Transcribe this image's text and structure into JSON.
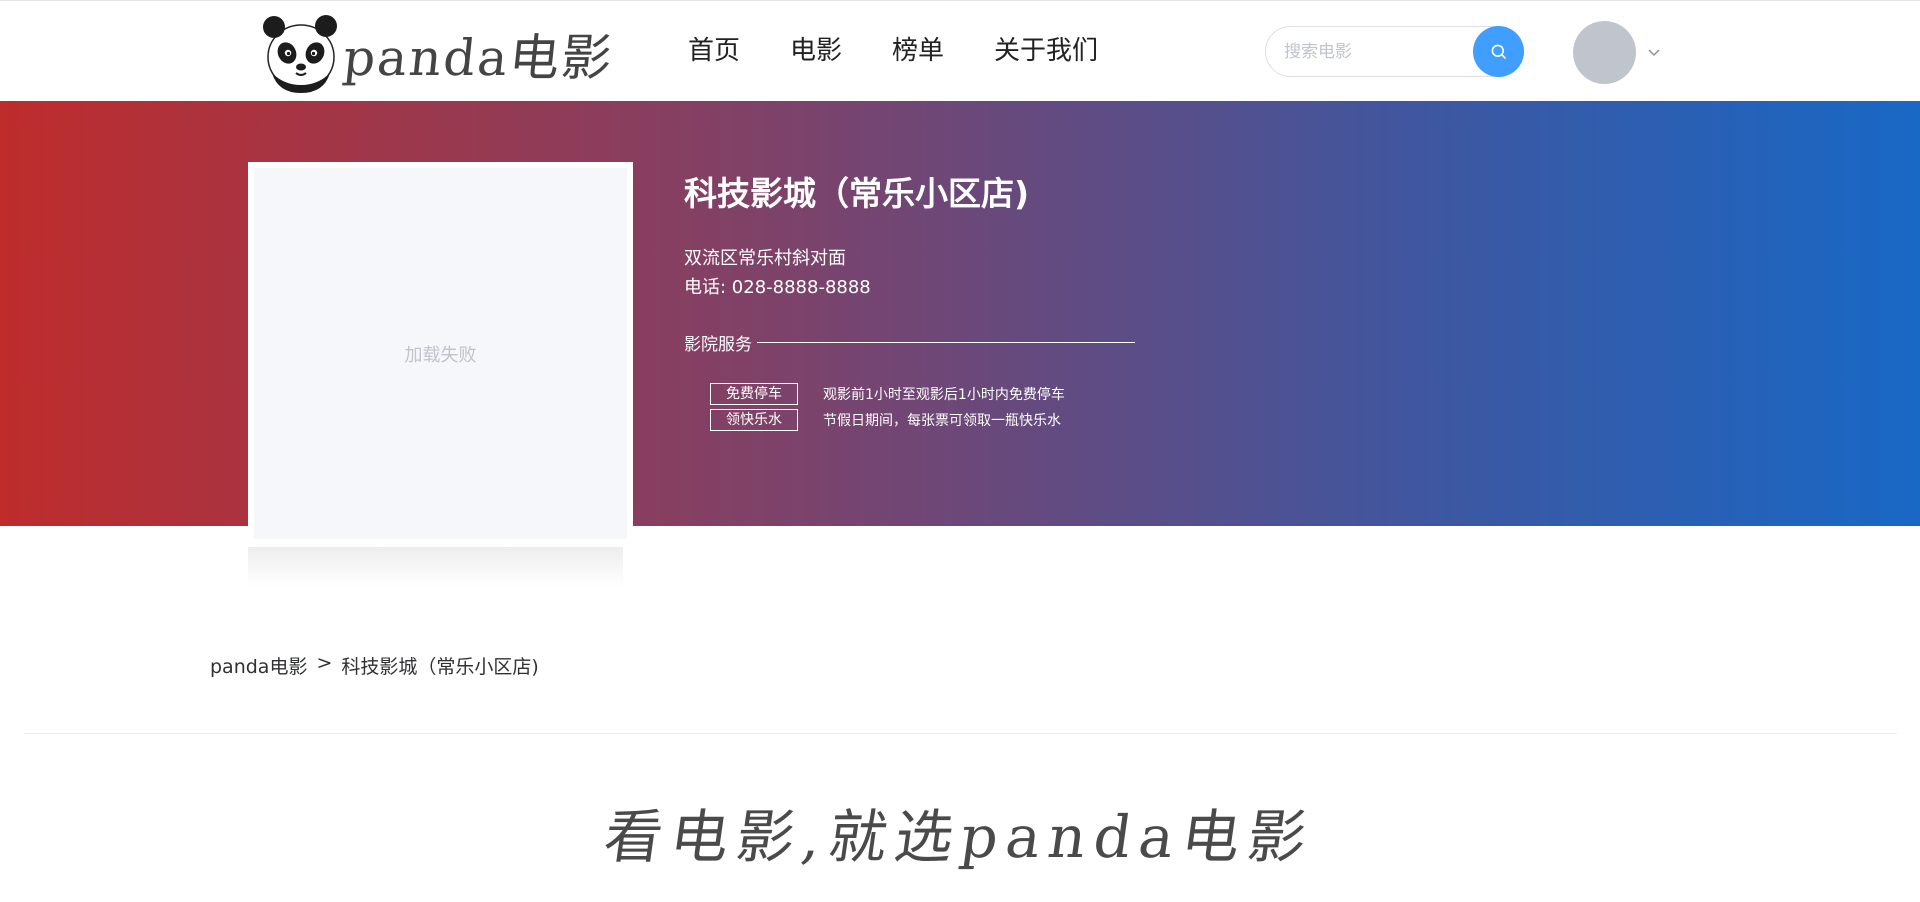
{
  "header": {
    "logo_text": "panda电影",
    "nav": [
      {
        "label": "首页"
      },
      {
        "label": "电影"
      },
      {
        "label": "榜单"
      },
      {
        "label": "关于我们"
      }
    ],
    "search": {
      "placeholder": "搜索电影",
      "value": ""
    },
    "icons": [
      "panda-logo-icon",
      "search-icon",
      "chevron-down-icon"
    ],
    "accent_color": "#409eff"
  },
  "cinema": {
    "poster_status": "加载失败",
    "name": "科技影城（常乐小区店)",
    "address": "双流区常乐村斜对面",
    "phone": "电话: 028-8888-8888",
    "services_title": "影院服务",
    "services": [
      {
        "tag": "免费停车",
        "desc": "观影前1小时至观影后1小时内免费停车"
      },
      {
        "tag": "领快乐水",
        "desc": "节假日期间，每张票可领取一瓶快乐水"
      }
    ],
    "banner_colors": [
      "#be2c2c",
      "#1868c6"
    ]
  },
  "breadcrumb": {
    "home": "panda电影",
    "separator": ">",
    "current": "科技影城（常乐小区店)"
  },
  "footer": {
    "slogan": "看电影,就选panda电影"
  }
}
